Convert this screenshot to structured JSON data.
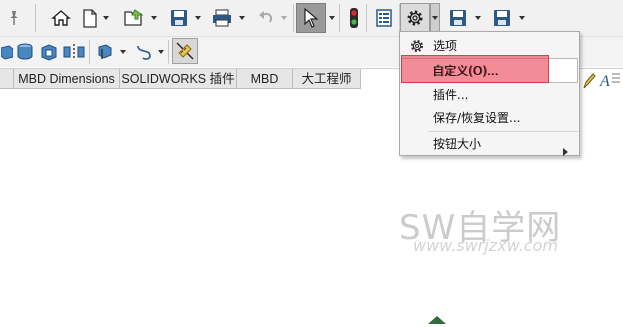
{
  "toolbar": {
    "pin_icon": "pin-icon",
    "icons": [
      "home-icon",
      "new-file-icon",
      "open-icon",
      "save-icon",
      "print-icon",
      "undo-icon",
      "select-cursor-icon",
      "rebuild-traffic-light-icon",
      "file-properties-icon",
      "options-gear-icon",
      "save-icon",
      "save-icon"
    ]
  },
  "tabs": [
    {
      "label": "MBD Dimensions"
    },
    {
      "label": "SOLIDWORKS 插件"
    },
    {
      "label": "MBD"
    },
    {
      "label": "大工程师"
    }
  ],
  "menu": {
    "items": [
      {
        "label": "选项",
        "icon": "gear-icon"
      },
      {
        "label": "自定义(O)...",
        "highlighted": true
      },
      {
        "label": "插件..."
      },
      {
        "label": "保存/恢复设置..."
      },
      {
        "label": "按钮大小",
        "submenu": true
      }
    ],
    "highlight_color": "#eb4655"
  },
  "watermark": {
    "title": "SW自学网",
    "url": "www.swrjzxw.com"
  }
}
